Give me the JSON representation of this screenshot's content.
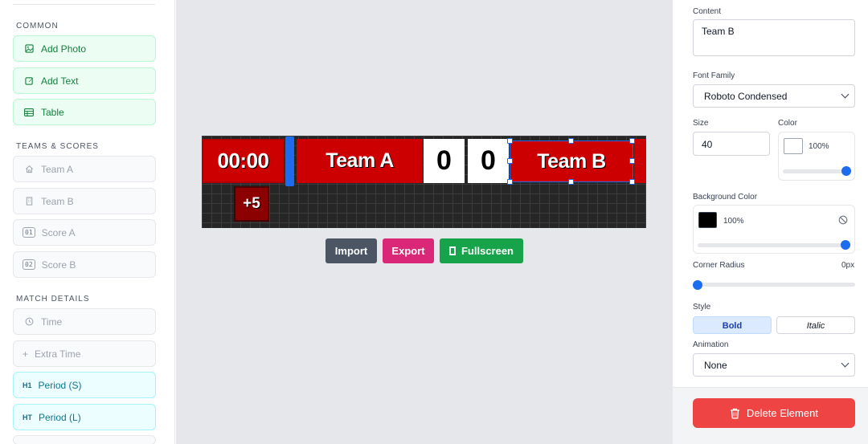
{
  "sidebar": {
    "sections": [
      {
        "title": "COMMON"
      },
      {
        "title": "TEAMS & SCORES"
      },
      {
        "title": "MATCH DETAILS"
      }
    ],
    "common": [
      {
        "label": "Add Photo",
        "icon": "image-icon"
      },
      {
        "label": "Add Text",
        "icon": "edit-icon"
      },
      {
        "label": "Table",
        "icon": "table-icon"
      }
    ],
    "teams": [
      {
        "label": "Team A",
        "icon": "home-icon"
      },
      {
        "label": "Team B",
        "icon": "building-icon"
      },
      {
        "label": "Score A",
        "badge": "01"
      },
      {
        "label": "Score B",
        "badge": "02"
      }
    ],
    "match": [
      {
        "label": "Time",
        "icon": "clock-icon"
      },
      {
        "label": "Extra Time",
        "prefix": "+"
      },
      {
        "label": "Period (S)",
        "prefix": "H1"
      },
      {
        "label": "Period (L)",
        "prefix": "HT"
      }
    ]
  },
  "scoreboard": {
    "timer": "00:00",
    "team_a": "Team A",
    "score_a": "0",
    "score_b": "0",
    "team_b": "Team B",
    "extra": "+5",
    "colors": {
      "red": "#cc0000",
      "dark_red": "#8b0000",
      "selection": "#1d6cf0"
    }
  },
  "actions": {
    "import": "Import",
    "export": "Export",
    "fullscreen": "Fullscreen"
  },
  "properties": {
    "content_label": "Content",
    "content_value": "Team B",
    "font_family_label": "Font Family",
    "font_family_value": "Roboto Condensed",
    "size_label": "Size",
    "size_value": "40",
    "color_label": "Color",
    "color_value": "#ffffff",
    "color_opacity": "100%",
    "bg_label": "Background Color",
    "bg_value": "#000000",
    "bg_opacity": "100%",
    "radius_label": "Corner Radius",
    "radius_value": "0px",
    "style_label": "Style",
    "style_bold": "Bold",
    "style_italic": "Italic",
    "animation_label": "Animation",
    "animation_value": "None",
    "delete_label": "Delete Element"
  }
}
